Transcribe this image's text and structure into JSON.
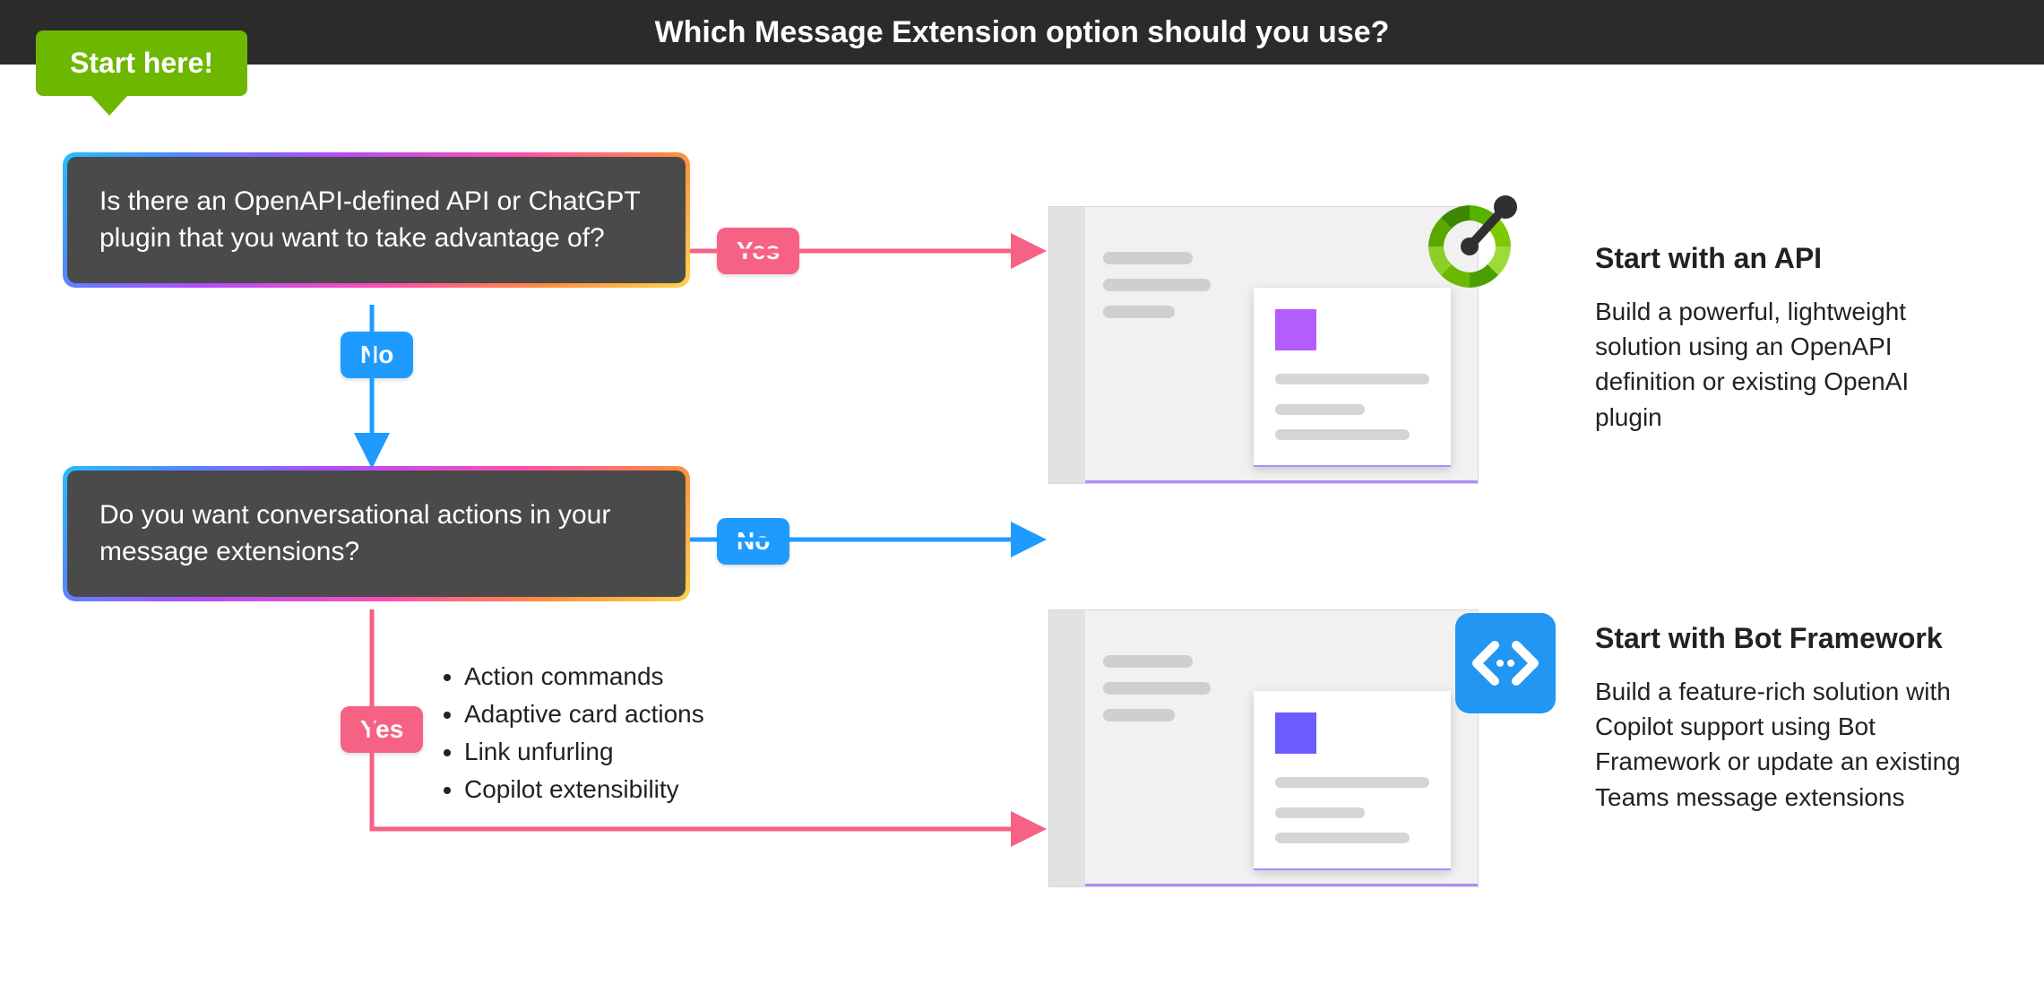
{
  "header": {
    "title": "Which Message Extension option should you use?"
  },
  "start_badge": "Start here!",
  "q1": "Is there an OpenAPI-defined API or ChatGPT plugin that you want to take advantage of?",
  "q2": "Do you want conversational actions in your message extensions?",
  "labels": {
    "yes": "Yes",
    "no": "No"
  },
  "bullets": [
    "Action commands",
    "Adaptive card actions",
    "Link unfurling",
    "Copilot extensibility"
  ],
  "api": {
    "title": "Start with an API",
    "desc": "Build a powerful, lightweight solution using an OpenAPI definition or existing OpenAI plugin"
  },
  "bot": {
    "title": "Start with Bot Framework",
    "desc": "Build a feature-rich solution with Copilot support using Bot Framework or update an existing Teams message extensions"
  },
  "colors": {
    "pink": "#f56283",
    "blue": "#1f9bff",
    "green": "#6db700",
    "charcoal": "#4a4a4a"
  }
}
